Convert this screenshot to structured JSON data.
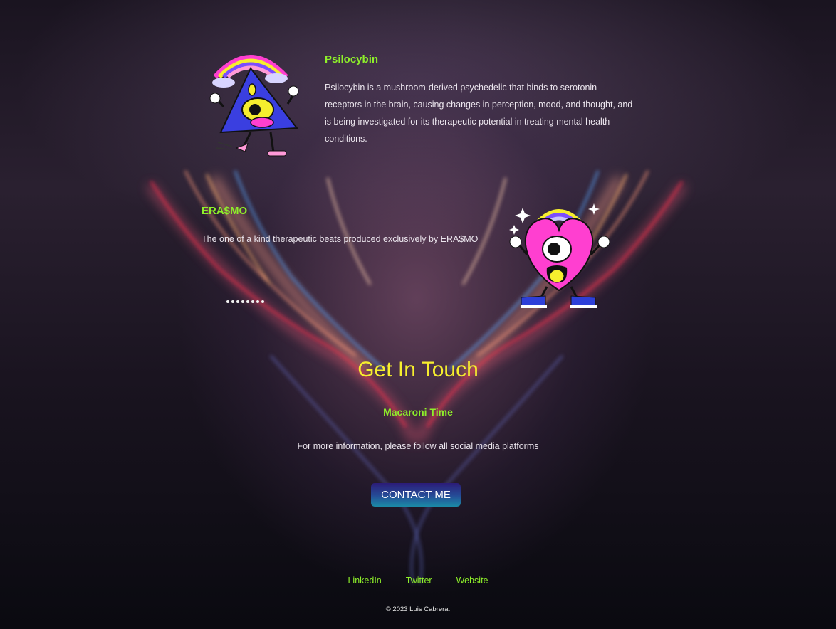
{
  "sections": {
    "psilocybin": {
      "title": "Psilocybin",
      "lines": [
        "Psilocybin is a mushroom-derived psychedelic that binds to serotonin",
        "receptors in the brain, causing changes in perception, mood, and thought, and",
        "is being investigated for its therapeutic potential in treating mental health",
        "conditions."
      ]
    },
    "erasmo": {
      "title": "ERA$MO",
      "text": "The one of a kind therapeutic beats produced exclusively by ERA$MO"
    }
  },
  "contact": {
    "title": "Get In Touch",
    "subtitle": "Macaroni Time",
    "text": "For more information, please follow all social media platforms",
    "button_label": "CONTACT ME"
  },
  "footer": {
    "links": [
      "LinkedIn",
      "Twitter",
      "Website"
    ],
    "copyright": "© 2023 Luis Cabrera."
  },
  "colors": {
    "heading_green": "#8ef02a",
    "headline_yellow": "#f6ee2e",
    "button_gradient": [
      "#2c1c78",
      "#1b8aa6"
    ]
  },
  "icons": {
    "psilocybin_character": "pyramid-eye-character-icon",
    "erasmo_character": "heart-eye-character-icon",
    "carousel": "dots-indicator"
  }
}
